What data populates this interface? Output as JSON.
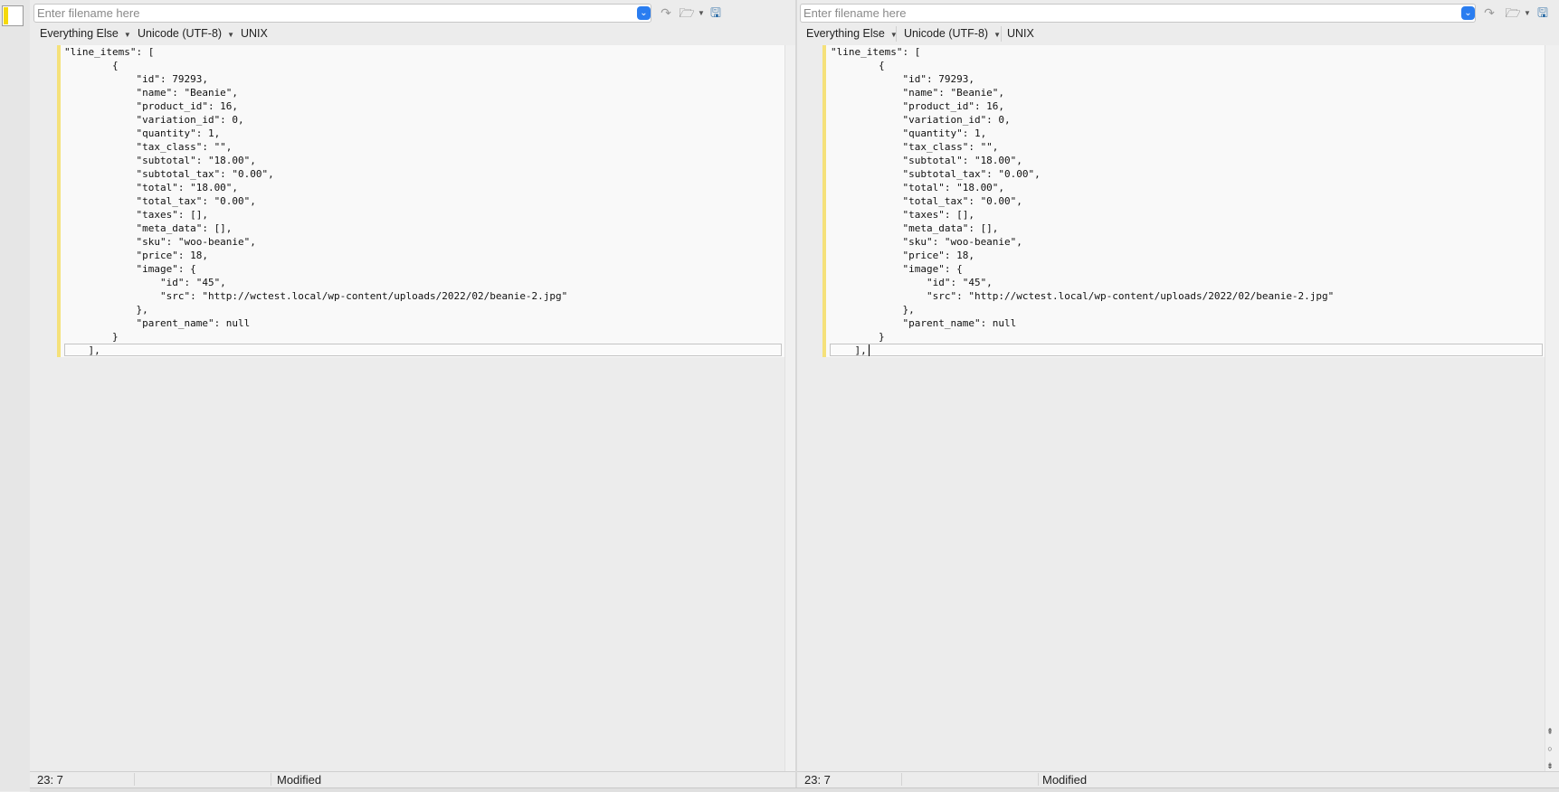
{
  "left": {
    "filename_placeholder": "Enter filename here",
    "filename_value": "",
    "mode": "Everything Else",
    "encoding": "Unicode (UTF-8)",
    "line_endings": "UNIX",
    "code": "\"line_items\": [\n        {\n            \"id\": 79293,\n            \"name\": \"Beanie\",\n            \"product_id\": 16,\n            \"variation_id\": 0,\n            \"quantity\": 1,\n            \"tax_class\": \"\",\n            \"subtotal\": \"18.00\",\n            \"subtotal_tax\": \"0.00\",\n            \"total\": \"18.00\",\n            \"total_tax\": \"0.00\",\n            \"taxes\": [],\n            \"meta_data\": [],\n            \"sku\": \"woo-beanie\",\n            \"price\": 18,\n            \"image\": {\n                \"id\": \"45\",\n                \"src\": \"http://wctest.local/wp-content/uploads/2022/02/beanie-2.jpg\"\n            },\n            \"parent_name\": null\n        }\n    ],",
    "status_position": "23: 7",
    "status_modified": "Modified"
  },
  "right": {
    "filename_placeholder": "Enter filename here",
    "filename_value": "",
    "mode": "Everything Else",
    "encoding": "Unicode (UTF-8)",
    "line_endings": "UNIX",
    "code": "\"line_items\": [\n        {\n            \"id\": 79293,\n            \"name\": \"Beanie\",\n            \"product_id\": 16,\n            \"variation_id\": 0,\n            \"quantity\": 1,\n            \"tax_class\": \"\",\n            \"subtotal\": \"18.00\",\n            \"subtotal_tax\": \"0.00\",\n            \"total\": \"18.00\",\n            \"total_tax\": \"0.00\",\n            \"taxes\": [],\n            \"meta_data\": [],\n            \"sku\": \"woo-beanie\",\n            \"price\": 18,\n            \"image\": {\n                \"id\": \"45\",\n                \"src\": \"http://wctest.local/wp-content/uploads/2022/02/beanie-2.jpg\"\n            },\n            \"parent_name\": null\n        }\n    ],",
    "status_position": "23: 7",
    "status_modified": "Modified"
  },
  "icons": {
    "dropdown": "chevron-down-icon",
    "nav_back": "back-arrow-icon",
    "open": "folder-icon",
    "save": "floppy-disk-icon",
    "nav_up": "navigate-up-icon",
    "nav_center": "navigate-center-icon",
    "nav_down": "navigate-down-icon"
  },
  "colors": {
    "accent": "#2a7df0",
    "change_bar": "#f5e17a",
    "save_icon": "#2f6fa8"
  }
}
